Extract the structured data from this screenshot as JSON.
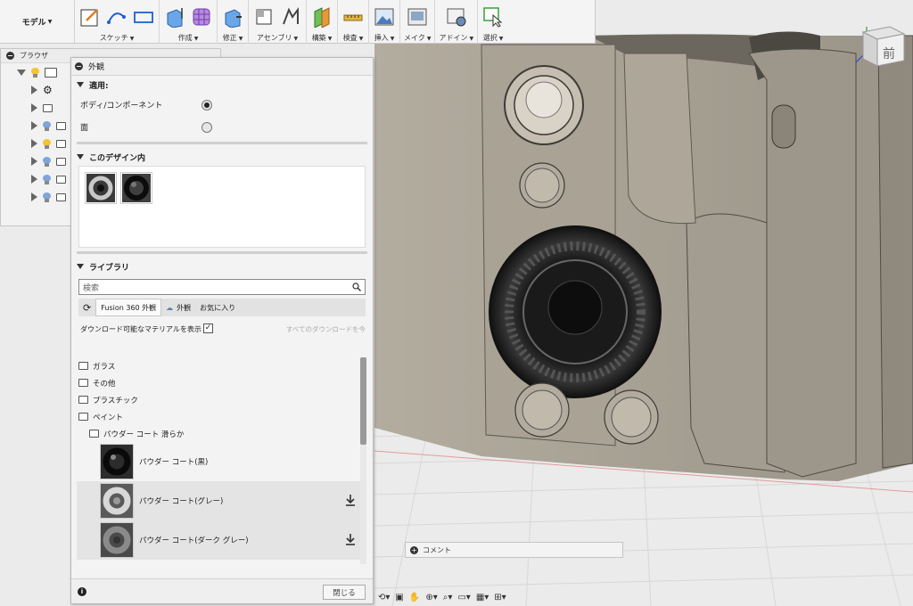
{
  "toolbar": {
    "mode_label": "モデル",
    "groups": [
      {
        "label": "スケッチ"
      },
      {
        "label": "作成"
      },
      {
        "label": "修正"
      },
      {
        "label": "アセンブリ"
      },
      {
        "label": "構築"
      },
      {
        "label": "検査"
      },
      {
        "label": "挿入"
      },
      {
        "label": "メイク"
      },
      {
        "label": "アドイン"
      },
      {
        "label": "選択"
      }
    ]
  },
  "browser": {
    "title": "ブラウザ"
  },
  "appearance": {
    "title": "外観",
    "apply": {
      "heading": "適用:",
      "option_body": "ボディ/コンポーネント",
      "option_face": "面"
    },
    "in_design": {
      "heading": "このデザイン内"
    },
    "library": {
      "heading": "ライブラリ",
      "search_placeholder": "検索",
      "tabs": [
        "Fusion 360 外観",
        "外観",
        "お気に入り"
      ],
      "show_downloadable": "ダウンロード可能なマテリアルを表示",
      "download_all": "すべてのダウンロードを今",
      "folders": [
        "ガラス",
        "その他",
        "プラスチック",
        "ペイント"
      ],
      "subfolder": "パウダー コート 滑らか",
      "materials": [
        "パウダー コート(黒)",
        "パウダー コート(グレー)",
        "パウダー コート(ダーク グレー)"
      ]
    },
    "close_label": "閉じる"
  },
  "comment": {
    "label": "コメント"
  },
  "viewcube": {
    "face_label": "前"
  }
}
